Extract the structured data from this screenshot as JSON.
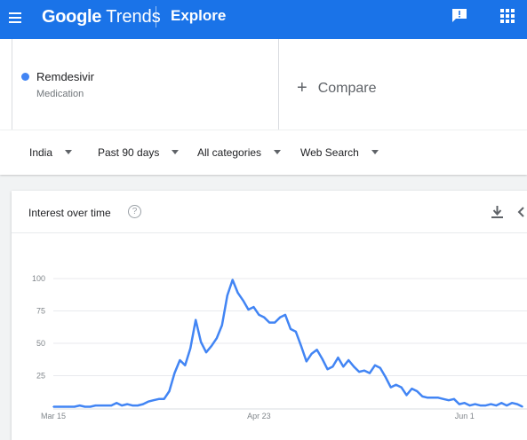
{
  "header": {
    "brand_google": "Google",
    "brand_trends": "Trends",
    "section": "Explore"
  },
  "icons": [
    "menu-icon",
    "feedback-icon",
    "apps-icon",
    "help-icon",
    "download-icon",
    "embed-icon"
  ],
  "term": {
    "name": "Remdesivir",
    "type": "Medication",
    "color": "#4285f4"
  },
  "compare_label": "Compare",
  "filters": {
    "region": "India",
    "time": "Past 90 days",
    "category": "All categories",
    "search_type": "Web Search"
  },
  "card": {
    "title": "Interest over time",
    "help": "?"
  },
  "chart_data": {
    "type": "line",
    "title": "",
    "xlabel": "",
    "ylabel": "",
    "ylim": [
      0,
      100
    ],
    "yticks": [
      25,
      50,
      75,
      100
    ],
    "x_tick_labels": [
      {
        "label": "Mar 15",
        "index": 0
      },
      {
        "label": "Apr 23",
        "index": 39
      },
      {
        "label": "Jun 1",
        "index": 78
      }
    ],
    "grid": true,
    "line_color": "#4285f4",
    "series": [
      {
        "values": [
          1,
          1,
          1,
          1,
          1,
          2,
          1,
          1,
          2,
          2,
          2,
          2,
          4,
          2,
          3,
          2,
          2,
          3,
          5,
          6,
          7,
          7,
          13,
          27,
          37,
          33,
          46,
          68,
          51,
          43,
          48,
          54,
          64,
          87,
          99,
          89,
          83,
          76,
          78,
          72,
          70,
          66,
          66,
          70,
          72,
          61,
          59,
          48,
          36,
          42,
          45,
          38,
          30,
          32,
          39,
          32,
          37,
          32,
          28,
          29,
          27,
          33,
          31,
          24,
          16,
          18,
          16,
          10,
          15,
          13,
          9,
          8,
          8,
          8,
          7,
          6,
          7,
          3,
          4,
          2,
          3,
          2,
          2,
          3,
          2,
          4,
          2,
          4,
          3,
          1
        ]
      }
    ]
  }
}
